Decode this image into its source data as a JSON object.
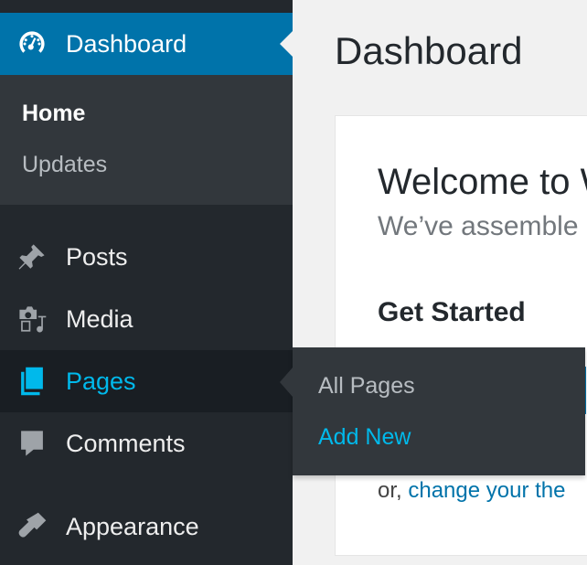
{
  "main": {
    "title": "Dashboard",
    "welcome": {
      "heading": "Welcome to W",
      "about": "We’ve assemble",
      "get_started": "Get Started",
      "or_text": "or,",
      "change_theme_link": "change your the"
    }
  },
  "sidebar": {
    "items": [
      {
        "label": "Dashboard",
        "icon": "dashboard-icon",
        "state": "current"
      },
      {
        "label": "Posts",
        "icon": "pin-icon"
      },
      {
        "label": "Media",
        "icon": "media-icon"
      },
      {
        "label": "Pages",
        "icon": "pages-icon",
        "state": "hovered"
      },
      {
        "label": "Comments",
        "icon": "comment-icon"
      },
      {
        "label": "Appearance",
        "icon": "brush-icon"
      }
    ],
    "dashboard_submenu": [
      {
        "label": "Home",
        "active": true
      },
      {
        "label": "Updates"
      }
    ]
  },
  "pages_flyout": {
    "items": [
      {
        "label": "All Pages"
      },
      {
        "label": "Add New"
      }
    ]
  },
  "colors": {
    "sidebar_bg": "#23282d",
    "submenu_bg": "#32373c",
    "accent": "#0073aa",
    "hover_text": "#00b9eb",
    "page_bg": "#f1f1f1"
  }
}
